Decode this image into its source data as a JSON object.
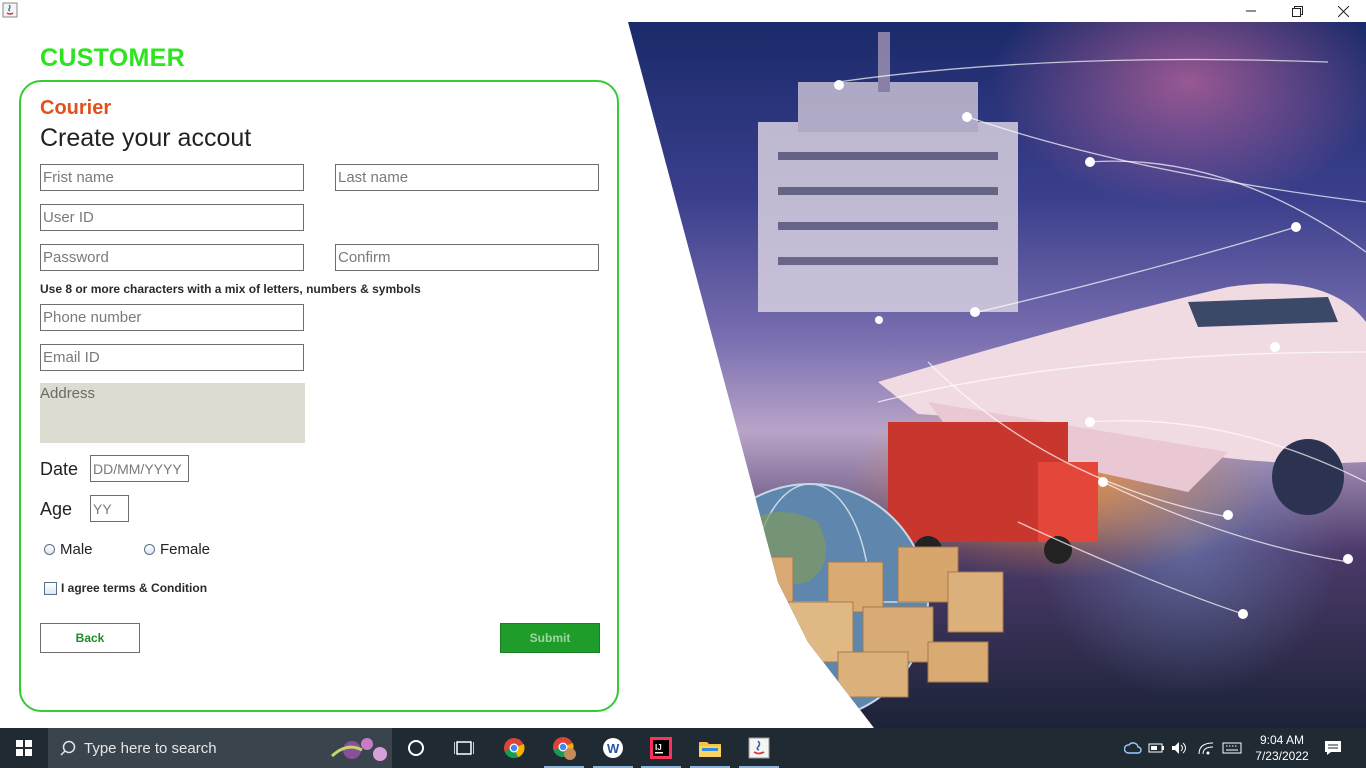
{
  "window": {
    "app_icon": "java-icon",
    "controls": [
      "minimize",
      "restore",
      "close"
    ]
  },
  "header": {
    "title": "CUSTOMER"
  },
  "form": {
    "brand": "Courier",
    "heading": "Create your accout",
    "first_name_placeholder": "Frist name",
    "last_name_placeholder": "Last name",
    "user_id_placeholder": "User ID",
    "password_placeholder": "Password",
    "confirm_placeholder": "Confirm",
    "password_hint": "Use 8 or more characters with a mix of letters, numbers & symbols",
    "phone_placeholder": "Phone number",
    "email_placeholder": "Email ID",
    "address_placeholder": "Address",
    "date_label": "Date",
    "date_placeholder": "DD/MM/YYYY",
    "age_label": "Age",
    "age_placeholder": "YY",
    "gender_options": [
      "Male",
      "Female"
    ],
    "terms_label": "I agree terms & Condition",
    "back_label": "Back",
    "submit_label": "Submit"
  },
  "colors": {
    "title_green": "#2ee31f",
    "panel_border": "#33cc33",
    "brand_orange": "#e4501c",
    "submit_bg": "#1f9d2a",
    "address_bg": "#dcdcd1"
  },
  "taskbar": {
    "search_placeholder": "Type here to search",
    "apps": [
      "windows-start-icon",
      "cortana-icon",
      "task-view-icon",
      "chrome-icon",
      "chrome-profile-icon",
      "word-icon",
      "intellij-icon",
      "file-explorer-icon",
      "java-icon"
    ],
    "tray": [
      "onedrive-icon",
      "battery-icon",
      "volume-icon",
      "wifi-icon",
      "keyboard-icon",
      "notification-icon"
    ],
    "time": "9:04 AM",
    "date": "7/23/2022"
  }
}
